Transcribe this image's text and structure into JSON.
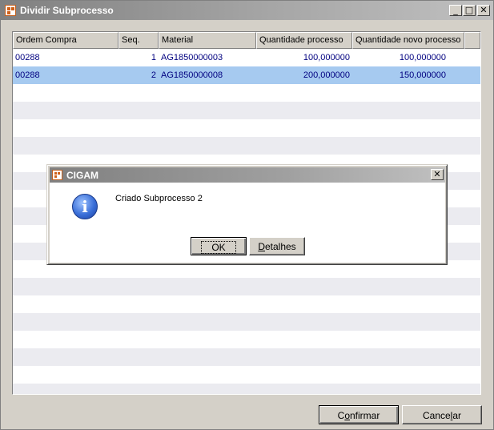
{
  "window": {
    "title": "Dividir Subprocesso",
    "controls": {
      "minimize": "_",
      "maximize": "□",
      "close": "✕"
    }
  },
  "grid": {
    "columns": [
      "Ordem Compra",
      "Seq.",
      "Material",
      "Quantidade processo",
      "Quantidade novo processo"
    ],
    "rows": [
      {
        "ordem": "00288",
        "seq": "1",
        "material": "AG1850000003",
        "qtd_processo": "100,000000",
        "qtd_novo": "100,000000",
        "selected": false
      },
      {
        "ordem": "00288",
        "seq": "2",
        "material": "AG1850000008",
        "qtd_processo": "200,000000",
        "qtd_novo": "150,000000",
        "selected": true
      }
    ]
  },
  "buttons": {
    "confirmar_pre": "C",
    "confirmar_key": "o",
    "confirmar_post": "nfirmar",
    "cancelar_pre": "Cance",
    "cancelar_key": "l",
    "cancelar_post": "ar"
  },
  "dialog": {
    "title": "CIGAM",
    "icon": "info-icon",
    "icon_glyph": "i",
    "message": "Criado Subprocesso 2",
    "ok_label": "OK",
    "details_key": "D",
    "details_rest": "etalhes",
    "close": "✕"
  },
  "colors": {
    "row_text": "#000080",
    "selected_row": "#a6caf0",
    "stripe_row": "#ebebf0"
  }
}
